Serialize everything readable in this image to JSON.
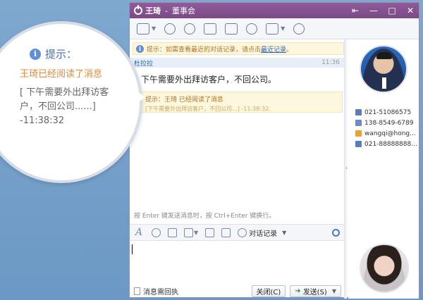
{
  "callout": {
    "tip_label": "提示：",
    "read_message": "王琦已经阅读了消息",
    "quote": "[ 下午需要外出拜访客户，不回公司......]",
    "time": "-11:38:32"
  },
  "window": {
    "contact_name": "王琦",
    "separator": "-",
    "group": "董事会",
    "controls": [
      "⇤",
      "—",
      "□",
      "✕"
    ]
  },
  "toolbar": {
    "icons": [
      "file-transfer-icon",
      "remote-assist-icon",
      "voice-icon",
      "video-icon",
      "screen-share-icon",
      "add-contact-icon",
      "app-icon",
      "location-icon"
    ]
  },
  "chat": {
    "notice1_prefix": "提示：如需查看最近的对话记录，请点击",
    "notice1_link": "最近记录",
    "notice1_suffix": "。",
    "sender": "杜拉拉",
    "message_time": "11:36",
    "message": "下午需要外出拜访客户，不回公司。",
    "notice2_line1": "提示：王琦 已经阅读了消息",
    "notice2_line2": "[下午需要外出拜访客户，不回公司...] -11:38:32."
  },
  "input": {
    "hint": "按 Enter 键发送消息时，按 Ctrl+Enter 键换行。",
    "history_label": "对话记录",
    "receipt_label": "消息需回执",
    "close_label": "关闭(C)",
    "send_label": "发送(S)"
  },
  "contact": {
    "phone": "021-51086575",
    "mobile": "138-8549-6789",
    "email": "wangqi@hong...",
    "fax": "021-88888888..."
  }
}
